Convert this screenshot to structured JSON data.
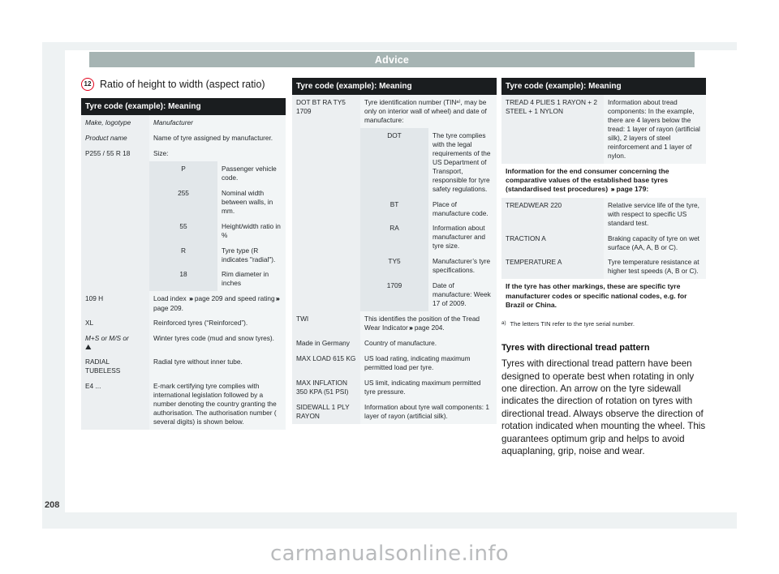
{
  "header": {
    "title": "Advice"
  },
  "page_number": "208",
  "watermark": "carmanualsonline.info",
  "section": {
    "badge": "12",
    "title": "Ratio of height to width (aspect ratio)"
  },
  "table1": {
    "head": "Tyre code (example): Meaning",
    "rows": [
      {
        "key": "Make, logotype",
        "value": "Manufacturer",
        "italic": true
      },
      {
        "key": "Product name",
        "value": "Name of tyre assigned by manufacturer.",
        "italic": true
      },
      {
        "key": "P255 / 55 R 18",
        "value": "Size:"
      },
      {
        "sub_key": "P",
        "value": "Passenger vehicle code."
      },
      {
        "sub_key": "255",
        "value": "Nominal width between walls, in mm."
      },
      {
        "sub_key": "55",
        "value": "Height/width ratio in %"
      },
      {
        "sub_key": "R",
        "value": "Tyre type (R indicates \"radial\")."
      },
      {
        "sub_key": "18",
        "value": "Rim diameter in inches"
      },
      {
        "key": "109 H",
        "value_pre": "Load index ",
        "chev": "›››",
        "value_mid": " page 209 and speed rating",
        "chev2": "›››",
        "value_post": " page 209."
      },
      {
        "key": "XL",
        "value": "Reinforced tyres (“Reinforced”)."
      },
      {
        "key": "M+S or M/S or",
        "snow": true,
        "value": "Winter tyres code (mud and snow tyres)."
      },
      {
        "key": "RADIAL TUBELESS",
        "value": "Radial tyre without inner tube."
      },
      {
        "key": "E4 ...",
        "value": "E-mark certifying tyre complies with international legislation followed by a number denoting the country granting the authorisation. The authorisation number ( several digits) is shown below."
      }
    ]
  },
  "table2": {
    "head": "Tyre code (example): Meaning",
    "rows": [
      {
        "key": "DOT BT RA TY5 1709",
        "value": "Tyre identification number (TINᵃ⁾, may be only on interior wall of wheel) and date of manufacture:"
      },
      {
        "sub_key": "DOT",
        "value": "The tyre complies with the legal requirements of the US Department of Transport, responsible for tyre safety regulations."
      },
      {
        "sub_key": "BT",
        "value": "Place of manufacture code."
      },
      {
        "sub_key": "RA",
        "value": "Information about manufacturer and tyre size."
      },
      {
        "sub_key": "TY5",
        "value": "Manufacturer’s tyre specifications."
      },
      {
        "sub_key": "1709",
        "value": "Date of manufacture: Week 17 of 2009."
      },
      {
        "key": "TWI",
        "value_pre": "This identifies the position of the Tread Wear Indicator",
        "chev": "›››",
        "value_post": " page 204."
      },
      {
        "key": "Made in Germany",
        "value": "Country of manufacture."
      },
      {
        "key": "MAX LOAD 615 KG",
        "value": "US load rating, indicating maximum permitted load per tyre."
      },
      {
        "key": "MAX INFLATION 350 KPA (51 PSI)",
        "value": "US limit, indicating maximum permitted tyre pressure."
      },
      {
        "key": "SIDEWALL 1 PLY RAYON",
        "value": "Information about tyre wall components:\n1 layer of rayon (artificial silk)."
      }
    ]
  },
  "table3": {
    "head": "Tyre code (example): Meaning",
    "rows": [
      {
        "key": "TREAD 4 PLIES 1 RAYON + 2 STEEL + 1 NYLON",
        "value": "Information about tread components:\nIn the example, there are 4 layers below the tread: 1 layer of rayon (artificial silk), 2 layers of steel reinforcement and 1 layer of nylon."
      }
    ],
    "note1_pre": "Information for the end consumer concerning the comparative values of the established base tyres (standardised test procedures) ",
    "note1_chev": "›››",
    "note1_post": " page 179:",
    "rows2": [
      {
        "key": "TREADWEAR 220",
        "value": "Relative service life of the tyre, with respect to specific US standard test."
      },
      {
        "key": "TRACTION A",
        "value": "Braking capacity of tyre on wet surface (AA, A, B or C)."
      },
      {
        "key": "TEMPERATURE A",
        "value": "Tyre temperature resistance at higher test speeds (A, B or C)."
      }
    ],
    "note2": "If the tyre has other markings, these are specific tyre manufacturer codes or specific national codes, e.g. for Brazil or China.",
    "footnote_mark": "a)",
    "footnote_text": "The letters TIN refer to the tyre serial number."
  },
  "directional": {
    "heading": "Tyres with directional tread pattern",
    "body": "Tyres with directional tread pattern have been designed to operate best when rotating in only one direction. An arrow on the tyre sidewall indicates the direction of rotation on tyres with directional tread. Always observe the direction of rotation indicated when mounting the wheel. This guarantees optimum grip and helps to avoid aquaplaning, grip, noise and wear."
  },
  "colors": {
    "header_bar": "#a6b4b3",
    "table_head": "#1a1d1f",
    "badge_ring": "#e2001a",
    "page_bg": "#eef2f3"
  }
}
